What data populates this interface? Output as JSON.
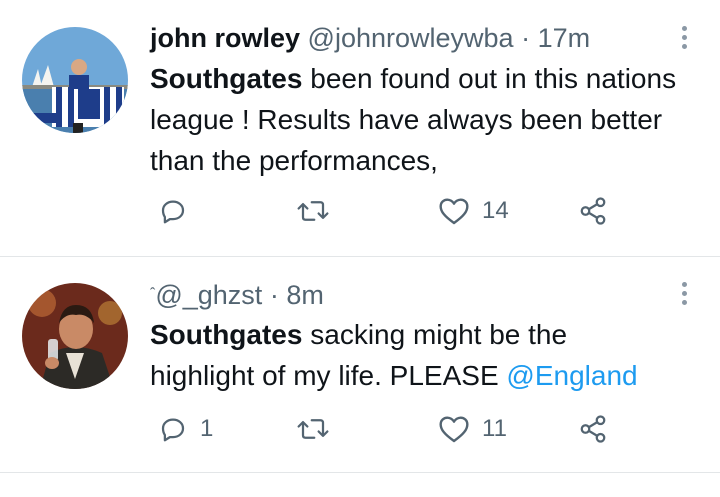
{
  "tweets": [
    {
      "name": "john rowley",
      "handle": "@johnrowleywba",
      "dot": "·",
      "time": "17m",
      "text_bold": "Southgates",
      "text_rest": " been found out in this nations league !  Results have always been better than the performances,",
      "mention": "",
      "reply_count": "",
      "retweet_count": "",
      "like_count": "14"
    },
    {
      "name_mark": "ˆ",
      "handle": "@_ghzst",
      "dot": "·",
      "time": "8m",
      "text_bold": "Southgates",
      "text_rest": " sacking might be the highlight of my life. PLEASE ",
      "mention": "@England",
      "reply_count": "1",
      "retweet_count": "",
      "like_count": "11"
    }
  ],
  "icons": {
    "reply": "reply-icon",
    "retweet": "retweet-icon",
    "like": "heart-icon",
    "share": "share-icon",
    "more": "more-options-icon"
  },
  "colors": {
    "text": "#0f1419",
    "secondary": "#536471",
    "link": "#1d9bf0",
    "divider": "#e3e6e8"
  }
}
